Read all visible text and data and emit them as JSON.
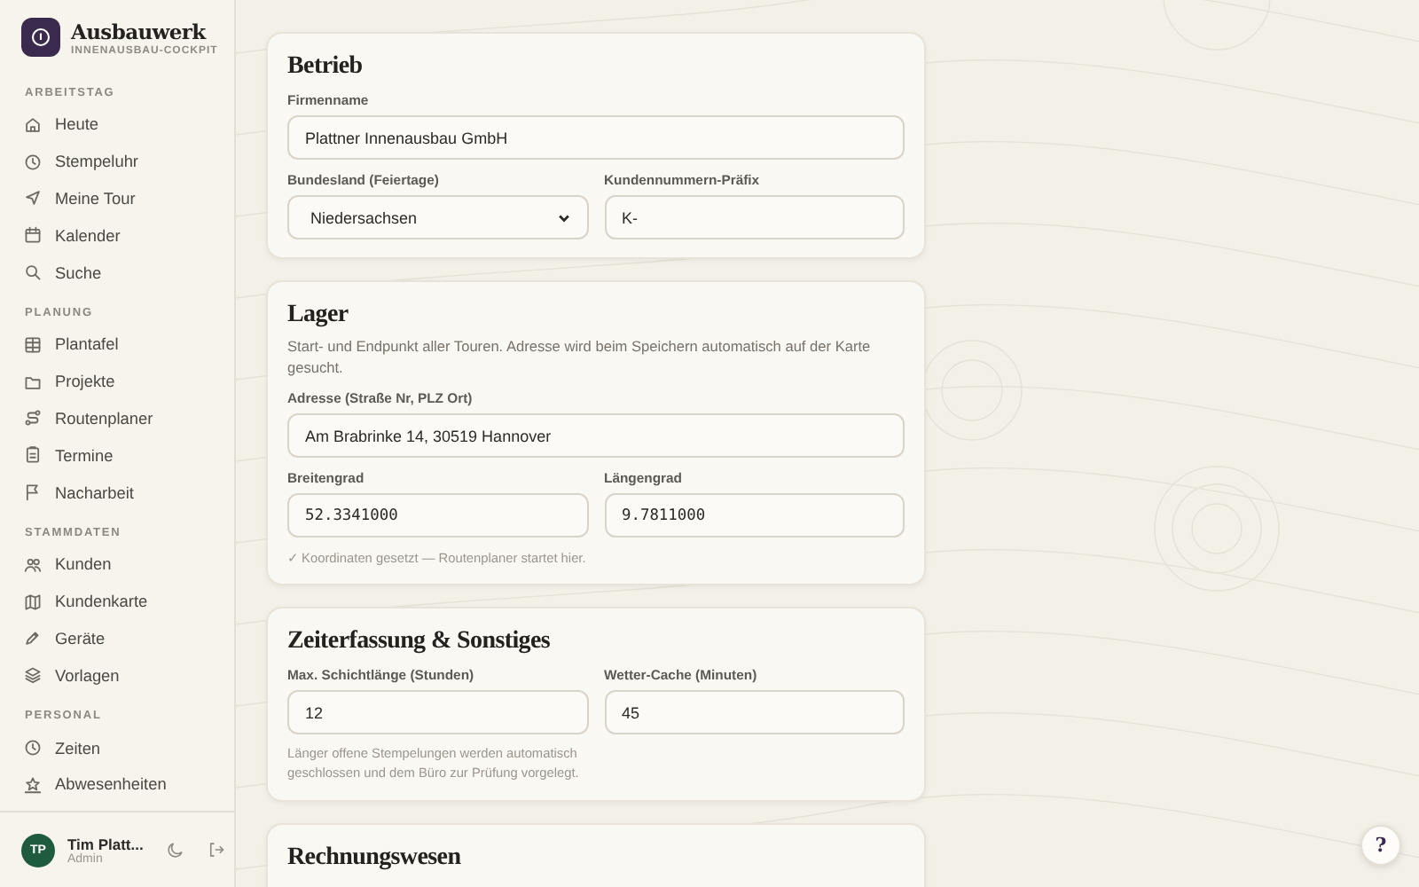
{
  "brand": {
    "title": "Ausbauwerk",
    "subtitle": "INNENAUSBAU-COCKPIT"
  },
  "sidebar": {
    "sections": [
      {
        "label": "ARBEITSTAG",
        "items": [
          {
            "label": "Heute"
          },
          {
            "label": "Stempeluhr"
          },
          {
            "label": "Meine Tour"
          },
          {
            "label": "Kalender"
          },
          {
            "label": "Suche"
          }
        ]
      },
      {
        "label": "PLANUNG",
        "items": [
          {
            "label": "Plantafel"
          },
          {
            "label": "Projekte"
          },
          {
            "label": "Routenplaner"
          },
          {
            "label": "Termine"
          },
          {
            "label": "Nacharbeit"
          }
        ]
      },
      {
        "label": "STAMMDATEN",
        "items": [
          {
            "label": "Kunden"
          },
          {
            "label": "Kundenkarte"
          },
          {
            "label": "Geräte"
          },
          {
            "label": "Vorlagen"
          }
        ]
      },
      {
        "label": "PERSONAL",
        "items": [
          {
            "label": "Zeiten"
          },
          {
            "label": "Abwesenheiten"
          }
        ]
      }
    ]
  },
  "user": {
    "initials": "TP",
    "name": "Tim Platt...",
    "role": "Admin"
  },
  "cards": [
    {
      "title": "Betrieb",
      "rows": [
        [
          {
            "label": "Firmenname",
            "value": "Plattner Innenausbau GmbH",
            "kind": "text"
          }
        ],
        [
          {
            "label": "Bundesland (Feiertage)",
            "value": "Niedersachsen",
            "kind": "select"
          },
          {
            "label": "Kundennummern-Präfix",
            "value": "K-",
            "kind": "text"
          }
        ]
      ]
    },
    {
      "title": "Lager",
      "description": "Start- und Endpunkt aller Touren. Adresse wird beim Speichern automatisch auf der Karte gesucht.",
      "rows": [
        [
          {
            "label": "Adresse (Straße Nr, PLZ Ort)",
            "value": "Am Brabrinke 14, 30519 Hannover",
            "kind": "text"
          }
        ],
        [
          {
            "label": "Breitengrad",
            "value": "52.3341000",
            "kind": "coordinate"
          },
          {
            "label": "Längengrad",
            "value": "9.7811000",
            "kind": "coordinate"
          }
        ]
      ],
      "note": "✓ Koordinaten gesetzt — Routenplaner startet hier."
    },
    {
      "title": "Zeiterfassung & Sonstiges",
      "rows": [
        [
          {
            "label": "Max. Schichtlänge (Stunden)",
            "value": "12",
            "kind": "text",
            "hint": "Länger offene Stempelungen werden automatisch geschlossen und dem Büro zur Prüfung vorgelegt."
          },
          {
            "label": "Wetter-Cache (Minuten)",
            "value": "45",
            "kind": "text"
          }
        ]
      ]
    },
    {
      "title": "Rechnungswesen"
    }
  ],
  "help_button": "?"
}
